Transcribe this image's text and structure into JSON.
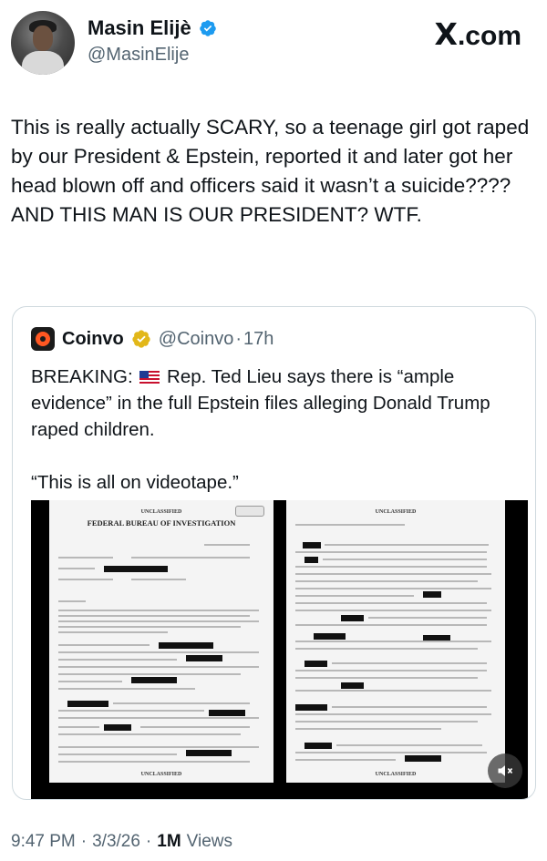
{
  "author": {
    "name": "Masin Elijè",
    "handle": "@MasinElije",
    "verified": true,
    "verified_color": "#1d9bf0"
  },
  "brand": {
    "logo_text": "X",
    "domain_text": ".com"
  },
  "tweet": {
    "text": "This is really actually SCARY, so a teenage girl got raped by our President & Epstein, reported it and later got her head blown off and officers said it wasn’t a suicide???? AND THIS MAN IS OUR PRESIDENT? WTF."
  },
  "quoted": {
    "name": "Coinvo",
    "handle": "@Coinvo",
    "separator": "·",
    "time": "17h",
    "badge_color": "#e2b719",
    "text_before_flag": "BREAKING:",
    "text_after_flag": "Rep. Ted Lieu says there is “ample evidence” in the full Epstein files alleging Donald Trump raped children.",
    "text_second": "“This is all on videotape.”",
    "media": {
      "page1_header": "UNCLASSIFIED",
      "page1_title": "FEDERAL BUREAU OF INVESTIGATION",
      "page1_footer": "UNCLASSIFIED",
      "page2_header": "UNCLASSIFIED",
      "page2_footer": "UNCLASSIFIED",
      "mute_icon": "speaker-muted-icon"
    }
  },
  "meta": {
    "time": "9:47 PM",
    "sep1": "·",
    "date": "3/3/26",
    "sep2": "·",
    "views_count": "1M",
    "views_label": "Views"
  }
}
